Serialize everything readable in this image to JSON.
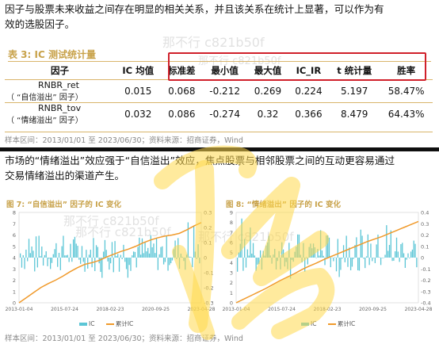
{
  "top": {
    "para_line1": "因子与股票未来收益之间存在明显的相关关系，并且该关系在统计上显著，可以作为有",
    "para_line2": "效的选股因子。",
    "table_caption": "表 3:  IC 测试统计量",
    "columns": [
      "因子",
      "IC 均值",
      "标准差",
      "最小值",
      "最大值",
      "IC_IR",
      "t 统计量",
      "胜率"
    ],
    "rows": [
      {
        "name": "RNBR_ret",
        "sub": "（ “自信溢出” 因子）",
        "values": [
          "0.015",
          "0.068",
          "-0.212",
          "0.269",
          "0.224",
          "5.197",
          "58.47%"
        ]
      },
      {
        "name": "RNBR_tov",
        "sub": "（ “情绪溢出” 因子）",
        "values": [
          "0.032",
          "0.086",
          "-0.274",
          "0.32",
          "0.366",
          "8.479",
          "64.43%"
        ]
      }
    ],
    "footnote": "样本区间：2013/01/01 至 2023/06/30；资料来源：招商证券，Wind"
  },
  "bottom": {
    "para_line1": "市场的“情绪溢出”效应强于“自信溢出”效应，焦点股票与相邻股票之间的互动更容易通过",
    "para_line2": "交易情绪溢出的渠道产生。",
    "footnote": "样本区间：2013/01/01 至 2023/06/30；资料来源：招商证券，Wind"
  },
  "watermarks": [
    "那不行 c821b50f",
    "那不行 c821b50f",
    "那不行 c821b50f",
    "那不行 c821b50f",
    "那不行 c821b50f"
  ],
  "highlight_color": "#d0202a",
  "chart_data": [
    {
      "type": "line",
      "title": "图 7:  “自信溢出” 因子的 IC 变化",
      "x_ticks": [
        "2013-01-04",
        "2015-07-24",
        "2018-02-23",
        "2020-09-25",
        "2023-04-28"
      ],
      "ylim_left": [
        0,
        8
      ],
      "y_ticks_left": [
        0,
        1,
        2,
        3,
        4,
        5,
        6,
        7,
        8
      ],
      "ylim_right": [
        -0.3,
        0.3
      ],
      "y_ticks_right": [
        -0.3,
        -0.2,
        -0.1,
        0,
        0.1,
        0.2,
        0.3
      ],
      "series": [
        {
          "name": "IC",
          "axis": "right",
          "style": "bar",
          "color": "#5cc6d6"
        },
        {
          "name": "累计IC",
          "axis": "left",
          "style": "line",
          "color": "#f09a2b",
          "values": [
            0,
            0.45,
            0.9,
            1.35,
            1.7,
            2.0,
            2.35,
            2.75,
            3.1,
            3.4,
            3.55,
            3.75,
            4.05,
            4.3,
            4.55,
            4.75,
            5.0,
            5.3,
            5.55,
            5.75,
            5.9,
            6.0,
            6.15,
            6.45,
            6.8,
            7.1
          ]
        }
      ]
    },
    {
      "type": "line",
      "title": "图 8:  “情绪溢出” 因子的 IC 变化",
      "x_ticks": [
        "2013-01-04",
        "2015-07-24",
        "2018-02-23",
        "2020-09-25",
        "2023-04-28"
      ],
      "ylim_left": [
        0,
        9
      ],
      "y_ticks_left": [
        0,
        1,
        2,
        3,
        4,
        5,
        6,
        7,
        8,
        9
      ],
      "ylim_right": [
        -0.4,
        0.4
      ],
      "y_ticks_right": [
        -0.4,
        -0.3,
        -0.2,
        -0.1,
        0,
        0.1,
        0.2,
        0.3,
        0.4
      ],
      "series": [
        {
          "name": "IC",
          "axis": "right",
          "style": "bar",
          "color": "#5cc6d6"
        },
        {
          "name": "累计IC",
          "axis": "left",
          "style": "line",
          "color": "#f09a2b",
          "values": [
            0,
            0.35,
            0.7,
            1.05,
            1.4,
            1.8,
            2.2,
            2.55,
            2.9,
            3.3,
            3.65,
            3.95,
            4.3,
            4.6,
            4.9,
            5.2,
            5.5,
            5.8,
            6.1,
            6.35,
            6.6,
            6.9,
            7.2,
            7.5,
            7.8,
            8.1
          ]
        }
      ]
    }
  ]
}
